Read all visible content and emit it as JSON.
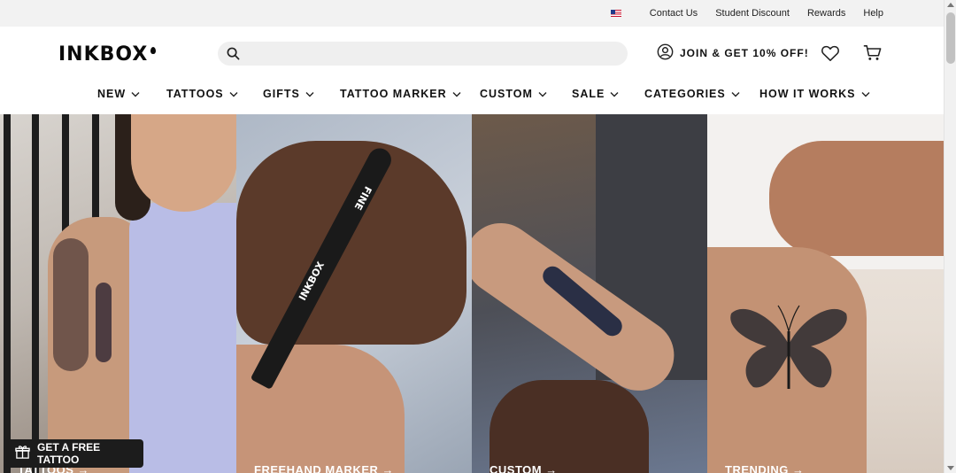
{
  "topbar": {
    "links": [
      "Contact Us",
      "Student Discount",
      "Rewards",
      "Help"
    ],
    "region_icon": "us-flag-icon"
  },
  "header": {
    "logo": "INKBOX",
    "search_placeholder": "",
    "join_label": "JOIN & GET 10% OFF!"
  },
  "nav": {
    "items": [
      {
        "label": "NEW"
      },
      {
        "label": "TATTOOS"
      },
      {
        "label": "GIFTS"
      },
      {
        "label": "TATTOO MARKER"
      },
      {
        "label": "CUSTOM"
      },
      {
        "label": "SALE"
      },
      {
        "label": "CATEGORIES"
      },
      {
        "label": "HOW IT WORKS"
      }
    ]
  },
  "hero": {
    "panels": [
      {
        "caption": "TATTOOS →"
      },
      {
        "caption": "FREEHAND MARKER →",
        "marker_text": "INKBOX",
        "marker_tip_text": "FINE"
      },
      {
        "caption": "CUSTOM →"
      },
      {
        "caption": "TRENDING →"
      }
    ]
  },
  "promo": {
    "label": "GET A FREE TATTOO"
  },
  "colors": {
    "brand": "#0a0a0a",
    "topbar_bg": "#f2f2f2",
    "search_bg": "#efefef",
    "promo_bg": "#1c1c1c"
  }
}
